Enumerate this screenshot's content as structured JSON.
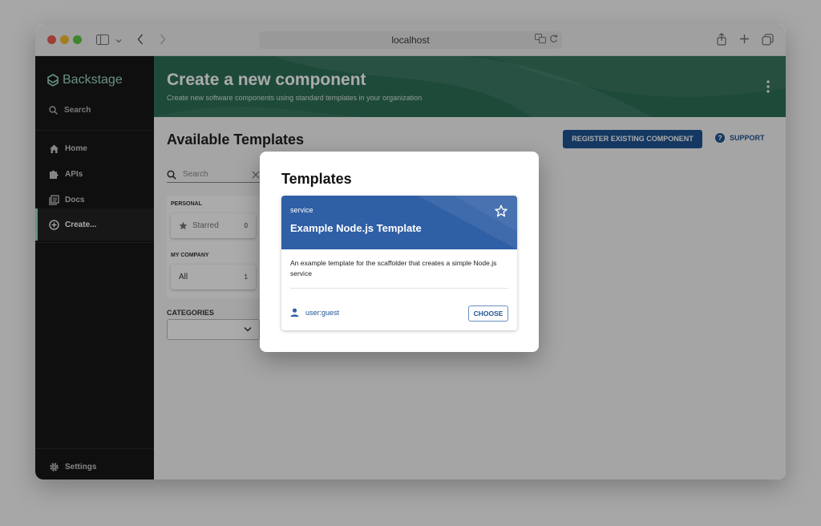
{
  "browser": {
    "url": "localhost"
  },
  "sidebar": {
    "logo_text": "Backstage",
    "search_label": "Search",
    "items": [
      {
        "label": "Home",
        "icon": "home-icon"
      },
      {
        "label": "APIs",
        "icon": "puzzle-icon"
      },
      {
        "label": "Docs",
        "icon": "docs-icon"
      },
      {
        "label": "Create...",
        "icon": "add-circle-icon",
        "active": true
      }
    ],
    "settings_label": "Settings",
    "accent_color": "#9bd8c6"
  },
  "header": {
    "title": "Create a new component",
    "subtitle": "Create new software components using standard templates in your organization",
    "color": "#2e6f57"
  },
  "main": {
    "page_title": "Available Templates",
    "register_button": "REGISTER EXISTING COMPONENT",
    "support_label": "SUPPORT",
    "search_placeholder": "Search",
    "filters": {
      "personal_label": "PERSONAL",
      "starred_label": "Starred",
      "starred_count": "0",
      "company_label": "MY COMPANY",
      "all_label": "All",
      "all_count": "1"
    },
    "categories_label": "CATEGORIES",
    "primary_color": "#1f5493"
  },
  "modal": {
    "title": "Templates",
    "template": {
      "type": "service",
      "name": "Example Node.js Template",
      "description": "An example template for the scaffolder that creates a simple Node.js service",
      "owner": "user:guest",
      "choose_label": "CHOOSE",
      "header_color": "#2f5fa5"
    }
  }
}
